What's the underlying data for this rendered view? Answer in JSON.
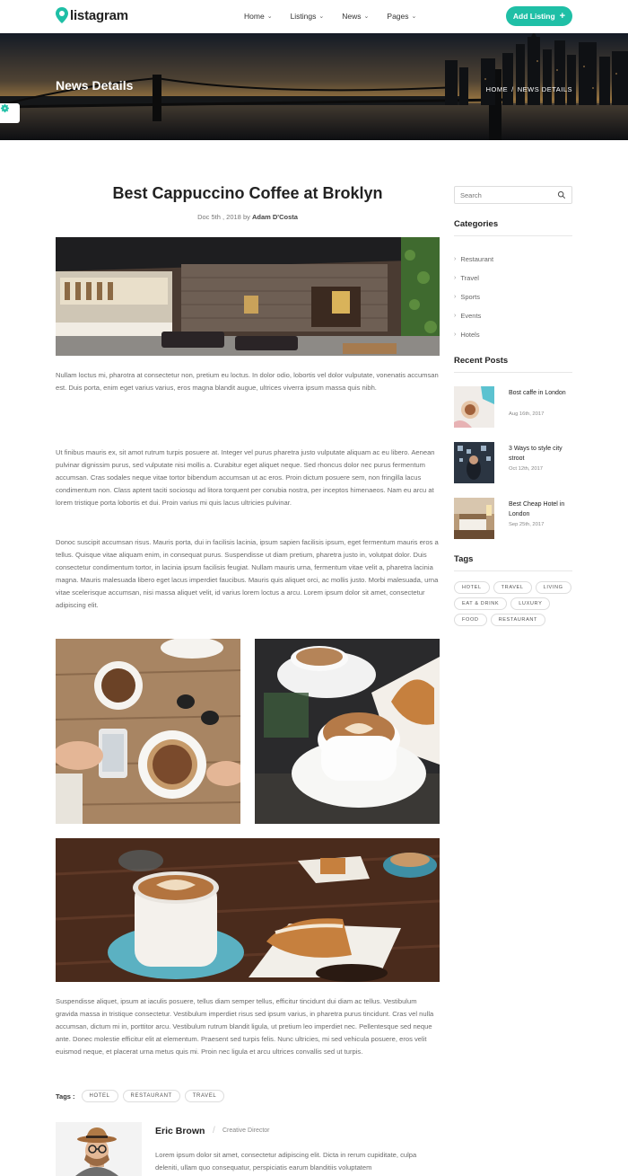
{
  "header": {
    "logo_text": "listagram",
    "nav": [
      {
        "label": "Home"
      },
      {
        "label": "Listings"
      },
      {
        "label": "News"
      },
      {
        "label": "Pages"
      }
    ],
    "add_listing_label": "Add Listing",
    "accent_color": "#1fbfa6"
  },
  "hero": {
    "title": "News Details",
    "breadcrumb": [
      "HOME",
      "/",
      "NEWS DETAILS"
    ]
  },
  "article": {
    "title": "Best Cappuccino Coffee at Broklyn",
    "date": "Doc 5th , 2018",
    "by": "by",
    "author": "Adam D'Costa",
    "paragraphs": [
      "Nullam loctus mi, pharotra at consectetur non, pretium eu loctus. In dolor odio, lobortis vel dolor vulputate, vonenatis accumsan est. Duis porta, enim eget varius varius, eros magna blandit augue, ultrices viverra ipsum massa quis nibh.",
      "Ut finibus mauris ex, sit amot rutrum turpis posuere at. Integer vel purus pharetra justo vulputate aliquam ac eu libero. Aenean pulvinar dignissim purus, sed vulputate nisi mollis a. Curabitur eget aliquet neque. Sed rhoncus dolor nec purus fermentum accumsan. Cras sodales neque vitae tortor bibendum accumsan ut ac eros. Proin dictum posuere sem, non fringilla lacus condimentum non. Class aptent taciti sociosqu ad litora torquent per conubia nostra, per inceptos himenaeos. Nam eu arcu at lorem tristique porta lobortis et dui. Proin varius mi quis lacus ultricies pulvinar.",
      "Donoc suscipit accumsan risus. Mauris porta, dui in facilisis lacinia, ipsum sapien facilisis ipsum, eget fermentum mauris eros a tellus. Quisque vitae aliquam enim, in consequat purus. Suspendisse ut diam pretium, pharetra justo in, volutpat dolor. Duis consectetur condimentum tortor, in lacinia ipsum facilisis feugiat. Nullam mauris urna, fermentum vitae velit a, pharetra lacinia magna. Mauris malesuada libero eget lacus imperdiet faucibus. Mauris quis aliquet orci, ac mollis justo. Morbi malesuada, urna vitae scelerisque accumsan, nisi massa aliquet velit, id varius lorem loctus a arcu. Lorem ipsum dolor sit amet, consectetur adipiscing elit.",
      "Suspendisse aliquet, ipsum at iaculis posuere, tellus diam semper tellus, efficitur tincidunt dui diam ac tellus. Vestibulum gravida massa in tristique consectetur. Vestibulum imperdiet risus sed ipsum varius, in pharetra purus tincidunt. Cras vel nulla accumsan, dictum mi in, porttitor arcu. Vestibulum rutrum blandit ligula, ut pretium leo imperdiet nec. Pellentesque sed neque ante. Donec molestie efficitur elit at elementum. Praesent sed turpis felis. Nunc ultricies, mi sed vehicula posuere, eros velit euismod neque, et placerat urna metus quis mi. Proin nec ligula et arcu ultrices convallis sed ut turpis."
    ],
    "tags_label": "Tags :",
    "tags": [
      "HOTEL",
      "RESTAURANT",
      "TRAVEL"
    ]
  },
  "author_box": {
    "name": "Eric Brown",
    "separator": "/",
    "role": "Creative Director",
    "bio": "Lorem ipsum dolor sit amet, consectetur adipiscing elit. Dicta in rerum cupiditate, culpa deleniti, ullam quo consequatur, perspiciatis earum blanditiis voluptatem"
  },
  "sidebar": {
    "search_placeholder": "Search",
    "categories_heading": "Categories",
    "categories": [
      "Restaurant",
      "Travel",
      "Sports",
      "Events",
      "Hotels"
    ],
    "recent_heading": "Recent Posts",
    "recent": [
      {
        "title": "Bost caffe in London",
        "date": "Aug 16th, 2017"
      },
      {
        "title": "3 Ways to style city stroot",
        "date": "Oct 12th, 2017"
      },
      {
        "title": "Best Cheap Hotel in London",
        "date": "Sep 25th, 2017"
      }
    ],
    "tags_heading": "Tags",
    "tags": [
      "HOTEL",
      "TRAVEL",
      "LIVING",
      "EAT & DRINK",
      "LUXURY",
      "FOOD",
      "RESTAURANT"
    ]
  }
}
